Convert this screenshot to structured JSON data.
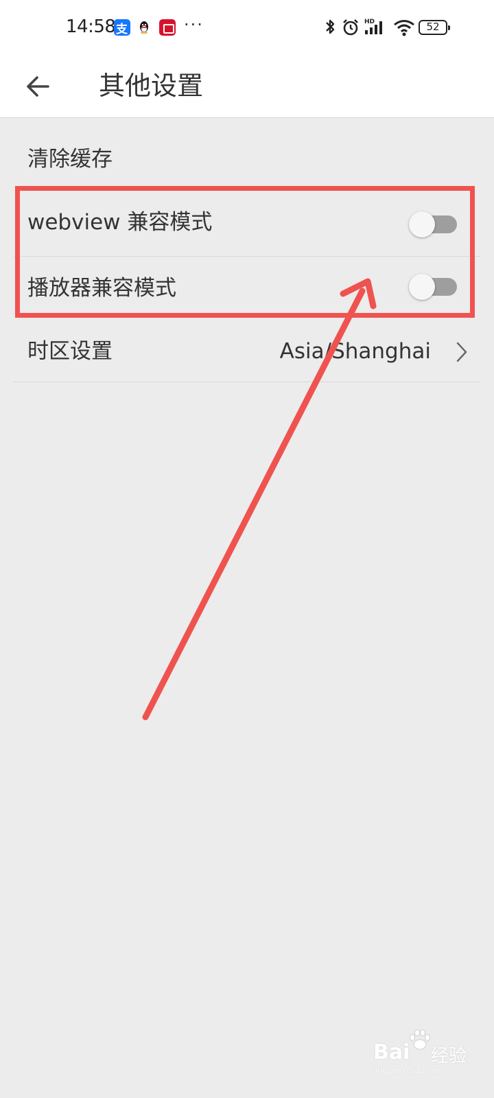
{
  "status_bar": {
    "time": "14:58",
    "more": "···",
    "battery": "52",
    "icons": [
      "alipay-icon",
      "qq-icon",
      "pinduoduo-icon",
      "bluetooth-icon",
      "alarm-icon",
      "hd-signal-icon",
      "wifi-icon",
      "battery-icon"
    ]
  },
  "toolbar": {
    "title": "其他设置",
    "back_icon": "arrow-left-icon"
  },
  "settings": {
    "clear_cache": "清除缓存",
    "webview_mode": {
      "label": "webview 兼容模式",
      "enabled": false
    },
    "player_mode": {
      "label": "播放器兼容模式",
      "enabled": false
    },
    "timezone": {
      "label": "时区设置",
      "value": "Asia/Shanghai"
    }
  },
  "annotation": {
    "highlight_color": "#ef5350"
  },
  "watermark": {
    "brand": "Bai",
    "brand_cn": "经验",
    "url": "jingyan.baidu.com"
  }
}
